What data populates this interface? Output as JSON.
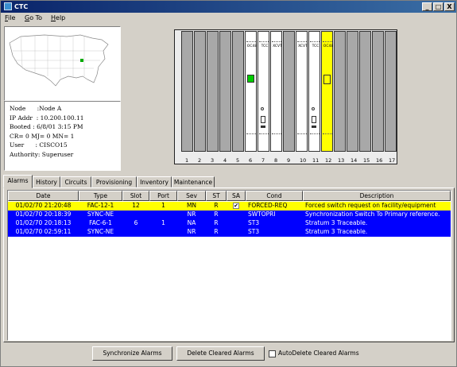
{
  "window": {
    "title": "CTC",
    "minimize": "_",
    "maximize": "□",
    "close": "X"
  },
  "menu": [
    {
      "prefix": "",
      "accel": "F",
      "rest": "ile"
    },
    {
      "prefix": "",
      "accel": "G",
      "rest": "o To"
    },
    {
      "prefix": "",
      "accel": "H",
      "rest": "elp"
    }
  ],
  "node_info": {
    "node": "Node      :Node A",
    "ip": "IP Addr  : 10.200.100.11",
    "booted": "Booted : 6/8/01 3:15 PM",
    "counts": "CR= 0 MJ= 0 MN= 1",
    "user": "User      : CISCO15",
    "authority": "Authority: Superuser"
  },
  "shelf": {
    "slot_numbers": [
      "1",
      "2",
      "3",
      "4",
      "5",
      "6",
      "7",
      "8",
      "9",
      "10",
      "11",
      "12",
      "13",
      "14",
      "15",
      "16",
      "17"
    ],
    "cards": {
      "s6": "OC48",
      "s7": "TCC",
      "s8": "XCVT",
      "s10": "XCVT",
      "s11": "TCC",
      "s12": "OC48"
    }
  },
  "tabs": [
    "Alarms",
    "History",
    "Circuits",
    "Provisioning",
    "Inventory",
    "Maintenance"
  ],
  "alarms": {
    "columns": [
      "Date",
      "Type",
      "Slot",
      "Port",
      "Sev",
      "ST",
      "SA",
      "Cond",
      "Description"
    ],
    "rows": [
      {
        "date": "01/02/70 21:20:48",
        "type": "FAC-12-1",
        "slot": "12",
        "port": "1",
        "sev": "MN",
        "st": "R",
        "sa": "✔",
        "cond": "FORCED-REQ",
        "desc": "Forced switch request on facility/equipment",
        "bg": "#ffff00",
        "fg": "#000000"
      },
      {
        "date": "01/02/70 20:18:39",
        "type": "SYNC-NE",
        "slot": "",
        "port": "",
        "sev": "NR",
        "st": "R",
        "sa": "",
        "cond": "SWTOPRI",
        "desc": "Synchronization Switch To Primary reference.",
        "bg": "#0000ff",
        "fg": "#ffffff"
      },
      {
        "date": "01/02/70 20:18:13",
        "type": "FAC-6-1",
        "slot": "6",
        "port": "1",
        "sev": "NA",
        "st": "R",
        "sa": "",
        "cond": "ST3",
        "desc": "Stratum 3 Traceable.",
        "bg": "#0000ff",
        "fg": "#ffffff"
      },
      {
        "date": "01/02/70 02:59:11",
        "type": "SYNC-NE",
        "slot": "",
        "port": "",
        "sev": "NR",
        "st": "R",
        "sa": "",
        "cond": "ST3",
        "desc": "Stratum 3 Traceable.",
        "bg": "#0000ff",
        "fg": "#ffffff"
      }
    ]
  },
  "buttons": {
    "sync": "Synchronize Alarms",
    "delete": "Delete Cleared Alarms",
    "auto_delete": "AutoDelete Cleared Alarms"
  }
}
